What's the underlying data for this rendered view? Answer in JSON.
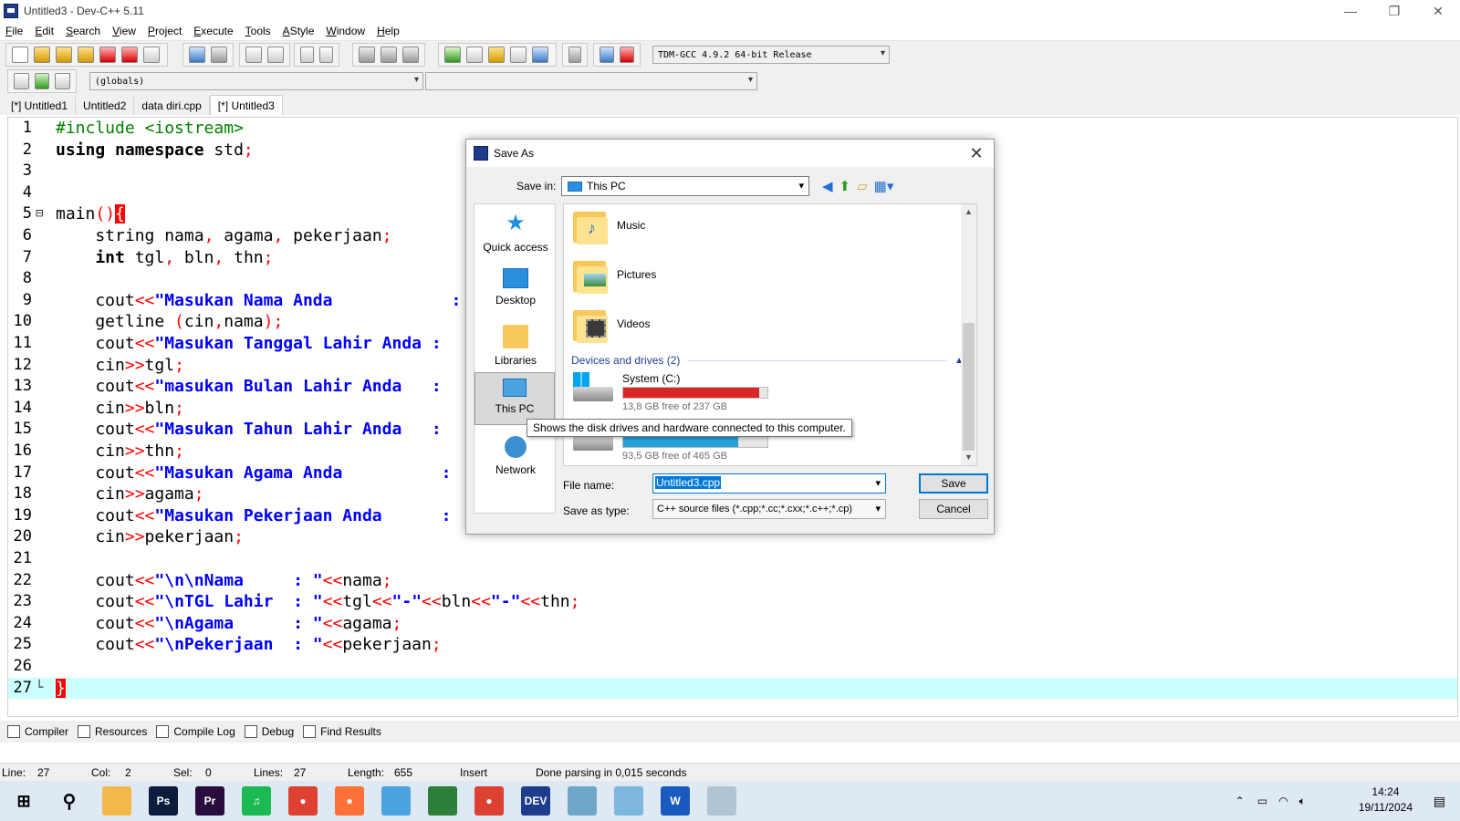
{
  "window": {
    "title": "Untitled3 - Dev-C++ 5.11",
    "minimize": "—",
    "maximize": "❐",
    "close": "✕"
  },
  "menu": [
    {
      "mnemonic": "F",
      "rest": "ile"
    },
    {
      "mnemonic": "E",
      "rest": "dit"
    },
    {
      "mnemonic": "S",
      "rest": "earch"
    },
    {
      "mnemonic": "V",
      "rest": "iew"
    },
    {
      "mnemonic": "P",
      "rest": "roject"
    },
    {
      "mnemonic": "E",
      "rest": "xecute"
    },
    {
      "mnemonic": "T",
      "rest": "ools"
    },
    {
      "mnemonic": "A",
      "rest": "Style"
    },
    {
      "mnemonic": "W",
      "rest": "indow"
    },
    {
      "mnemonic": "H",
      "rest": "elp"
    }
  ],
  "toolbar": {
    "compiler_select": "TDM-GCC 4.9.2 64-bit Release",
    "scope_select": "(globals)",
    "function_select": ""
  },
  "tabs": [
    "[*] Untitled1",
    "Untitled2",
    "data diri.cpp",
    "[*] Untitled3"
  ],
  "editor": {
    "line_numbers": [
      "1",
      "2",
      "3",
      "4",
      "5",
      "6",
      "7",
      "8",
      "9",
      "10",
      "11",
      "12",
      "13",
      "14",
      "15",
      "16",
      "17",
      "18",
      "19",
      "20",
      "21",
      "22",
      "23",
      "24",
      "25",
      "26",
      "27"
    ],
    "fold_open": "⊟",
    "fold_end": "└"
  },
  "code": {
    "l1": "#include <iostream>",
    "l2a": "using namespace",
    "l2b": " std",
    "l2c": ";",
    "l5a": "main",
    "l5b": "()",
    "l5c": "{",
    "l6a": "    string nama",
    "l6b": ",",
    "l6c": " agama",
    "l6d": ",",
    "l6e": " pekerjaan",
    "l6f": ";",
    "l7a": "    int",
    "l7b": " tgl",
    "l7c": ",",
    "l7d": " bln",
    "l7e": ",",
    "l7f": " thn",
    "l7g": ";",
    "l9a": "    cout",
    "l9b": "<<",
    "l9c": "\"Masukan Nama Anda            :",
    "l10a": "    getline ",
    "l10b": "(",
    "l10c": "cin",
    "l10d": ",",
    "l10e": "nama",
    "l10f": ");",
    "l11a": "    cout",
    "l11b": "<<",
    "l11c": "\"Masukan Tanggal Lahir Anda :",
    "l12a": "    cin",
    "l12b": ">>",
    "l12c": "tgl",
    "l12d": ";",
    "l13a": "    cout",
    "l13b": "<<",
    "l13c": "\"masukan Bulan Lahir Anda   :",
    "l14a": "    cin",
    "l14b": ">>",
    "l14c": "bln",
    "l14d": ";",
    "l15a": "    cout",
    "l15b": "<<",
    "l15c": "\"Masukan Tahun Lahir Anda   :",
    "l16a": "    cin",
    "l16b": ">>",
    "l16c": "thn",
    "l16d": ";",
    "l17a": "    cout",
    "l17b": "<<",
    "l17c": "\"Masukan Agama Anda          :",
    "l18a": "    cin",
    "l18b": ">>",
    "l18c": "agama",
    "l18d": ";",
    "l19a": "    cout",
    "l19b": "<<",
    "l19c": "\"Masukan Pekerjaan Anda      :",
    "l20a": "    cin",
    "l20b": ">>",
    "l20c": "pekerjaan",
    "l20d": ";",
    "l22a": "    cout",
    "l22b": "<<",
    "l22c": "\"\\n\\nNama     : \"",
    "l22d": "<<",
    "l22e": "nama",
    "l22f": ";",
    "l23a": "    cout",
    "l23b": "<<",
    "l23c": "\"\\nTGL Lahir  : \"",
    "l23d": "<<",
    "l23e": "tgl",
    "l23f": "<<",
    "l23g": "\"-\"",
    "l23h": "<<",
    "l23i": "bln",
    "l23j": "<<",
    "l23k": "\"-\"",
    "l23l": "<<",
    "l23m": "thn",
    "l23n": ";",
    "l24a": "    cout",
    "l24b": "<<",
    "l24c": "\"\\nAgama      : \"",
    "l24d": "<<",
    "l24e": "agama",
    "l24f": ";",
    "l25a": "    cout",
    "l25b": "<<",
    "l25c": "\"\\nPekerjaan  : \"",
    "l25d": "<<",
    "l25e": "pekerjaan",
    "l25f": ";",
    "l27": "}"
  },
  "bottom_tabs": [
    "Compiler",
    "Resources",
    "Compile Log",
    "Debug",
    "Find Results"
  ],
  "status": {
    "line_label": "Line:",
    "line": "27",
    "col_label": "Col:",
    "col": "2",
    "sel_label": "Sel:",
    "sel": "0",
    "lines_label": "Lines:",
    "lines": "27",
    "length_label": "Length:",
    "length": "655",
    "mode": "Insert",
    "message": "Done parsing in 0,015 seconds"
  },
  "dialog": {
    "title": "Save As",
    "close": "✕",
    "save_in_label": "Save in:",
    "save_in_value": "This PC",
    "places": [
      "Quick access",
      "Desktop",
      "Libraries",
      "This PC",
      "Network"
    ],
    "folders": [
      "Music",
      "Pictures",
      "Videos"
    ],
    "group_header": "Devices and drives (2)",
    "drives": [
      {
        "name": "System (C:)",
        "free": "13,8 GB free of 237 GB",
        "used_fraction": 0.94,
        "color": "#da2626"
      },
      {
        "name": "",
        "free": "93,5 GB free of 465 GB",
        "used_fraction": 0.8,
        "color": "#26a0da"
      }
    ],
    "tooltip": "Shows the disk drives and hardware connected to this computer.",
    "file_name_label": "File name:",
    "file_name_value": "Untitled3.cpp",
    "save_type_label": "Save as type:",
    "save_type_value": "C++ source files (*.cpp;*.cc;*.cxx;*.c++;*.cp)",
    "save_button": "Save",
    "cancel_button": "Cancel"
  },
  "taskbar": {
    "time": "14:24",
    "date": "19/11/2024",
    "apps": [
      {
        "name": "file-explorer",
        "label": "",
        "color": "#f2b84b"
      },
      {
        "name": "photoshop",
        "label": "Ps",
        "color": "#0b1c3d"
      },
      {
        "name": "premiere",
        "label": "Pr",
        "color": "#2a0b3d"
      },
      {
        "name": "spotify",
        "label": "♫",
        "color": "#1db954"
      },
      {
        "name": "chrome",
        "label": "●",
        "color": "#de4032"
      },
      {
        "name": "firefox",
        "label": "●",
        "color": "#ff7139"
      },
      {
        "name": "app7",
        "label": "",
        "color": "#4aa3df"
      },
      {
        "name": "app8",
        "label": "",
        "color": "#2d7f3a"
      },
      {
        "name": "chrome-profile",
        "label": "●",
        "color": "#de4032"
      },
      {
        "name": "devcpp",
        "label": "DEV",
        "color": "#1e3c8c"
      },
      {
        "name": "app11",
        "label": "",
        "color": "#6fa7c9"
      },
      {
        "name": "app12",
        "label": "",
        "color": "#7eb7de"
      },
      {
        "name": "word",
        "label": "W",
        "color": "#185abd"
      },
      {
        "name": "app14",
        "label": "",
        "color": "#b0c4d4"
      }
    ]
  }
}
